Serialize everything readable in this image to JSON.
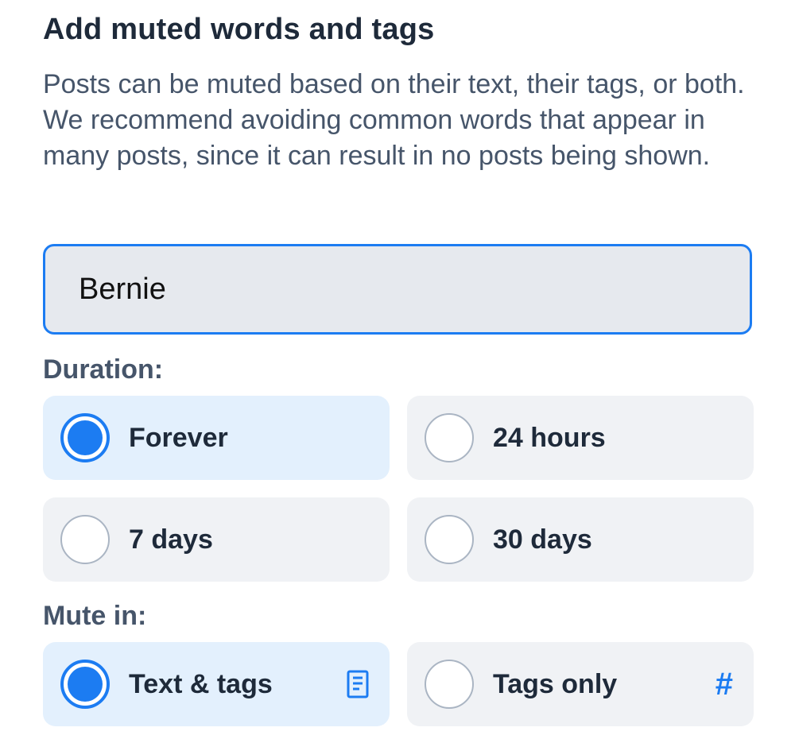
{
  "header": {
    "title": "Add muted words and tags",
    "description": "Posts can be muted based on their text, their tags, or both. We recommend avoiding common words that appear in many posts, since it can result in no posts being shown."
  },
  "input": {
    "value": "Bernie"
  },
  "duration": {
    "label": "Duration:",
    "options": [
      {
        "label": "Forever",
        "selected": true
      },
      {
        "label": "24 hours",
        "selected": false
      },
      {
        "label": "7 days",
        "selected": false
      },
      {
        "label": "30 days",
        "selected": false
      }
    ]
  },
  "mute_in": {
    "label": "Mute in:",
    "options": [
      {
        "label": "Text & tags",
        "selected": true,
        "icon": "document-icon"
      },
      {
        "label": "Tags only",
        "selected": false,
        "icon": "hashtag-icon",
        "icon_glyph": "#"
      }
    ]
  },
  "colors": {
    "accent": "#1c7cf2",
    "selected_bg": "#e3f0fd",
    "unselected_bg": "#f0f2f5",
    "title": "#1e2a3a",
    "muted_text": "#46556a"
  }
}
